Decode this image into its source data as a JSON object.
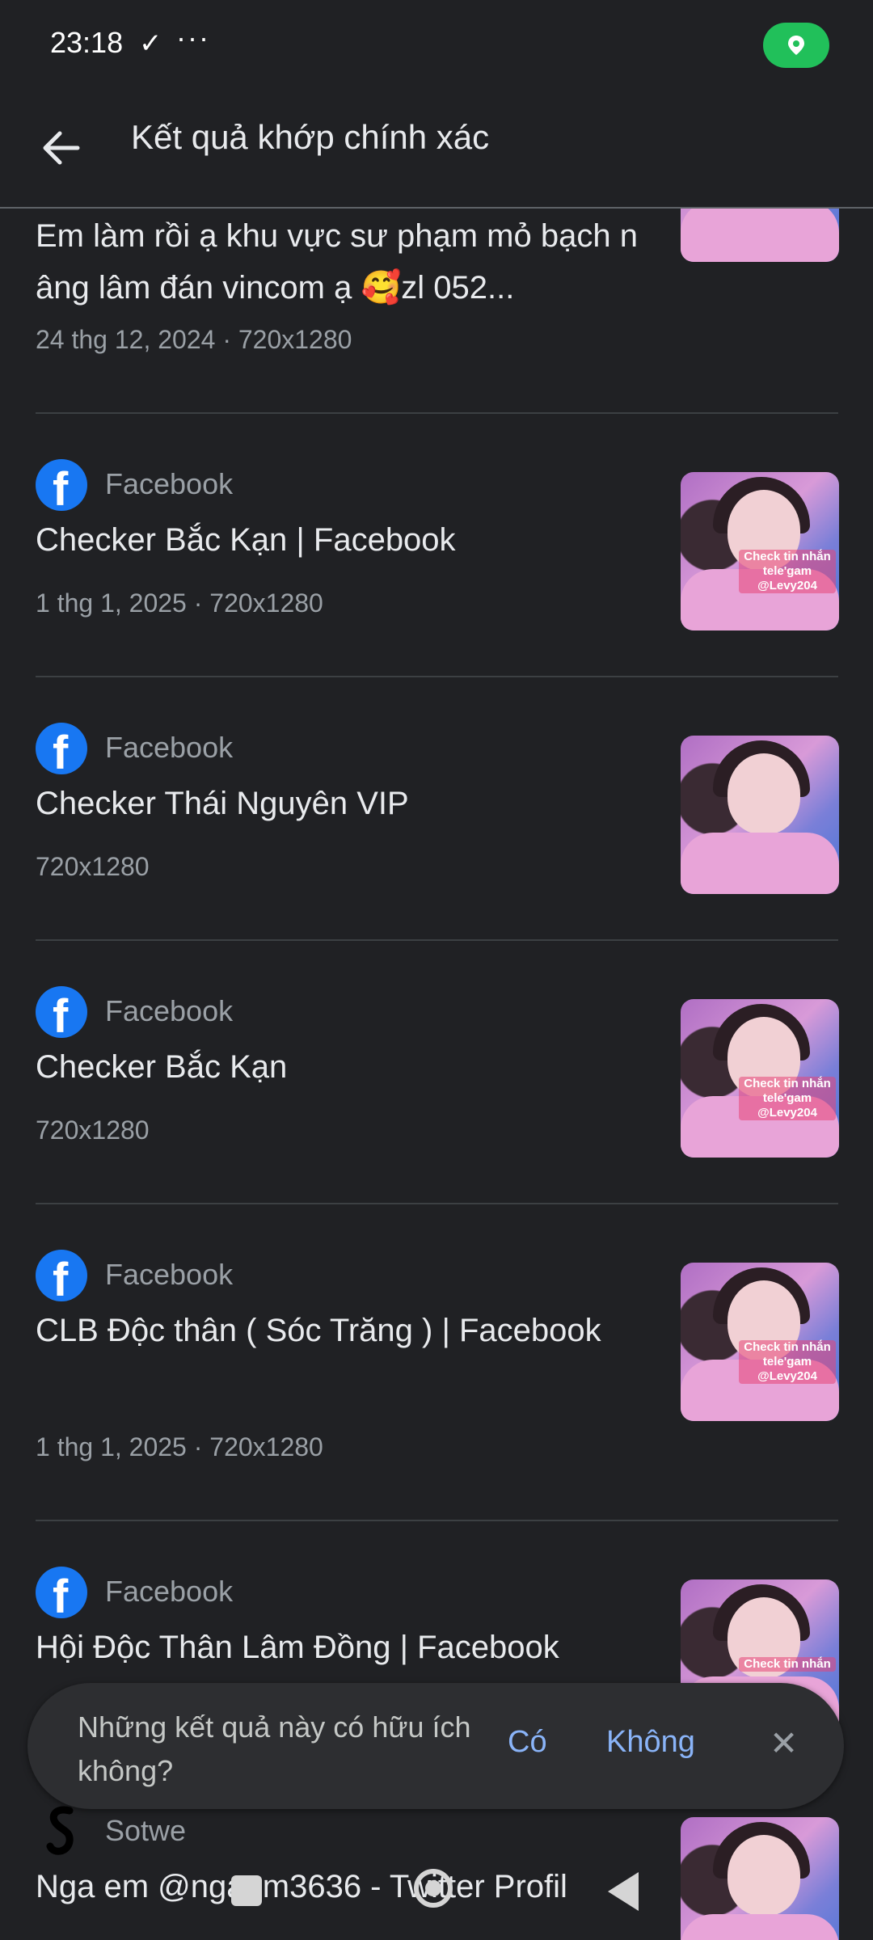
{
  "status_bar": {
    "time": "23:18",
    "check": "✓",
    "dots": "···"
  },
  "header": {
    "title": "Kết quả khớp chính xác"
  },
  "results": [
    {
      "source": "",
      "title": "Em làm rồi ạ khu vực sư phạm mỏ bạch nâng lâm đán vincom ạ 🥰zl 052...",
      "meta": "24 thg 12, 2024 · 720x1280",
      "thumb_label": ""
    },
    {
      "source": "Facebook",
      "title": "Checker Bắc Kạn | Facebook",
      "meta": "1 thg 1, 2025 · 720x1280",
      "thumb_label": "Check tin nhắn tele'gam @Levy204"
    },
    {
      "source": "Facebook",
      "title": "Checker Thái Nguyên VIP",
      "meta": "720x1280",
      "thumb_label": ""
    },
    {
      "source": "Facebook",
      "title": "Checker Bắc Kạn",
      "meta": "720x1280",
      "thumb_label": "Check tin nhắn tele'gam @Levy204"
    },
    {
      "source": "Facebook",
      "title": "CLB Độc thân ( Sóc Trăng ) | Facebook",
      "meta": "1 thg 1, 2025 · 720x1280",
      "thumb_label": "Check tin nhắn tele'gam @Levy204"
    },
    {
      "source": "Facebook",
      "title": "Hội Độc Thân Lâm Đồng | Facebook",
      "meta": "",
      "thumb_label": "Check tin nhắn"
    },
    {
      "source": "Sotwe",
      "title": "Nga em @ngaem3636 - Twitter Profil",
      "meta": "",
      "thumb_label": ""
    }
  ],
  "feedback": {
    "question": "Những kết quả này có hữu ích không?",
    "yes": "Có",
    "no": "Không",
    "close": "✕"
  },
  "colors": {
    "background": "#202124",
    "accent": "#8ab4f8",
    "facebook": "#1877f2",
    "location_pill": "#21c05a"
  }
}
